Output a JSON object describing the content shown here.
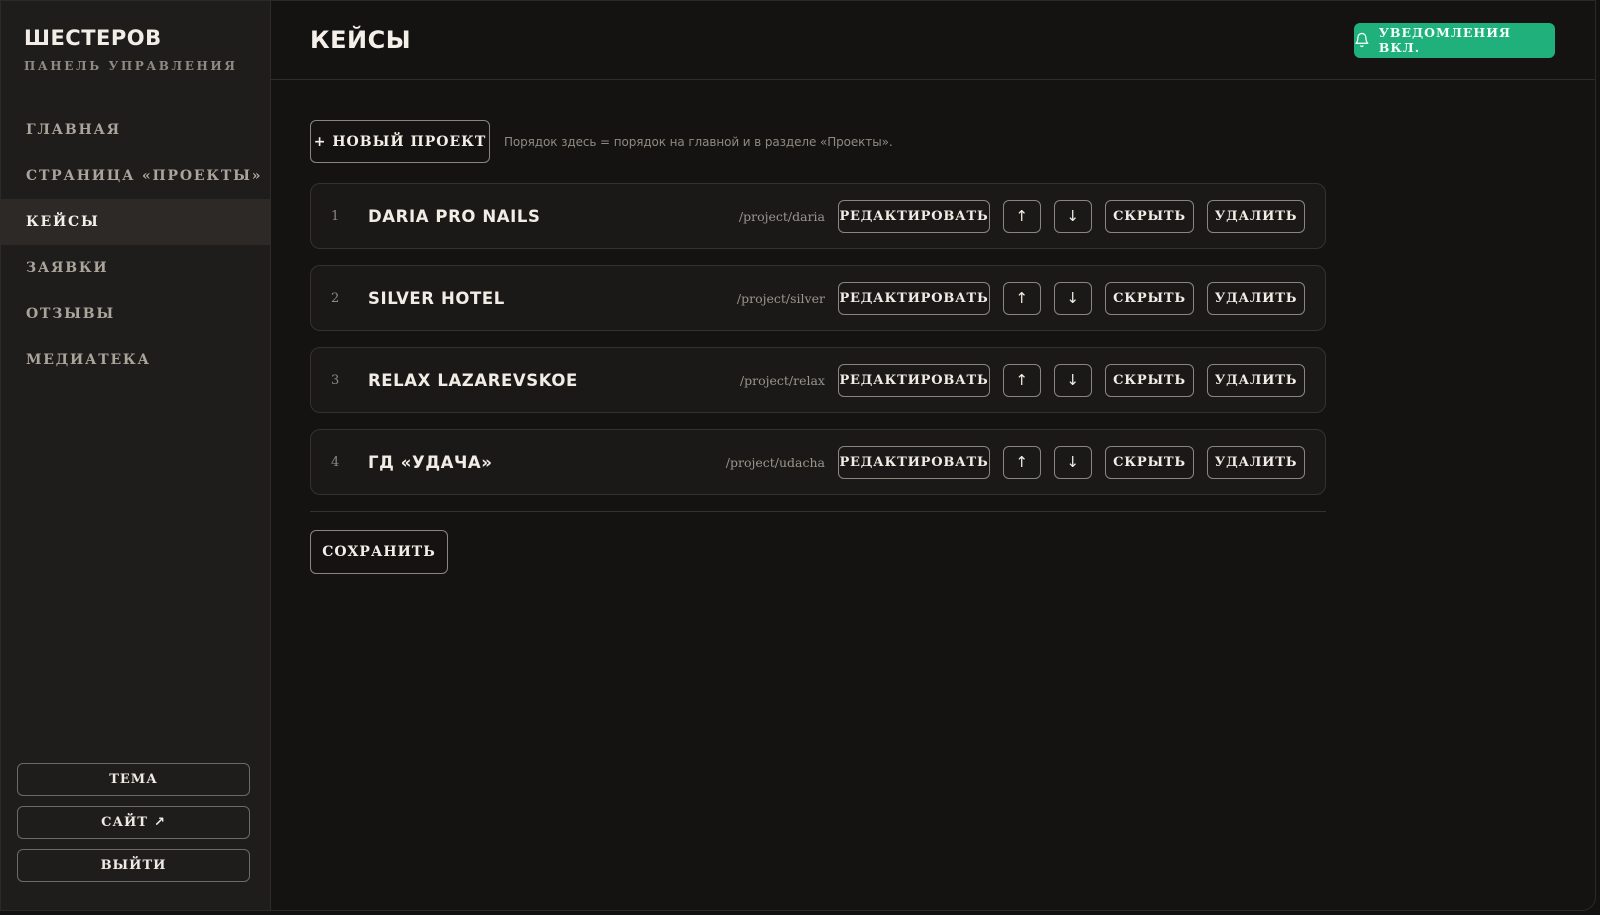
{
  "brand": {
    "name": "ШЕСТЕРОВ",
    "subtitle": "ПАНЕЛЬ УПРАВЛЕНИЯ"
  },
  "sidebar": {
    "items": [
      {
        "label": "ГЛАВНАЯ",
        "active": false
      },
      {
        "label": "СТРАНИЦА «ПРОЕКТЫ»",
        "active": false
      },
      {
        "label": "КЕЙСЫ",
        "active": true
      },
      {
        "label": "ЗАЯВКИ",
        "active": false
      },
      {
        "label": "ОТЗЫВЫ",
        "active": false
      },
      {
        "label": "МЕДИАТЕКА",
        "active": false
      }
    ],
    "theme_label": "ТЕМА",
    "site_label": "САЙТ",
    "site_arrow": "↗",
    "logout_label": "ВЫЙТИ"
  },
  "header": {
    "title": "КЕЙСЫ",
    "notifications_label": "УВЕДОМЛЕНИЯ ВКЛ.",
    "notifications_icon": "bell-icon"
  },
  "toolbar": {
    "new_project_label": "+ НОВЫЙ ПРОЕКТ",
    "hint": "Порядок здесь = порядок на главной и в разделе «Проекты»."
  },
  "projects": [
    {
      "num": "1",
      "title": "DARIA PRO NAILS",
      "slug": "/project/daria"
    },
    {
      "num": "2",
      "title": "SILVER HOTEL",
      "slug": "/project/silver"
    },
    {
      "num": "3",
      "title": "RELAX LAZAREVSKOE",
      "slug": "/project/relax"
    },
    {
      "num": "4",
      "title": "ГД «УДАЧА»",
      "slug": "/project/udacha"
    }
  ],
  "row_actions": {
    "edit": "РЕДАКТИРОВАТЬ",
    "up": "↑",
    "down": "↓",
    "hide": "СКРЫТЬ",
    "delete": "УДАЛИТЬ"
  },
  "save_label": "СОХРАНИТЬ",
  "colors": {
    "accent": "#20b07c",
    "background": "#151311",
    "sidebar": "#1f1d1b",
    "active_item": "#2c2926"
  }
}
